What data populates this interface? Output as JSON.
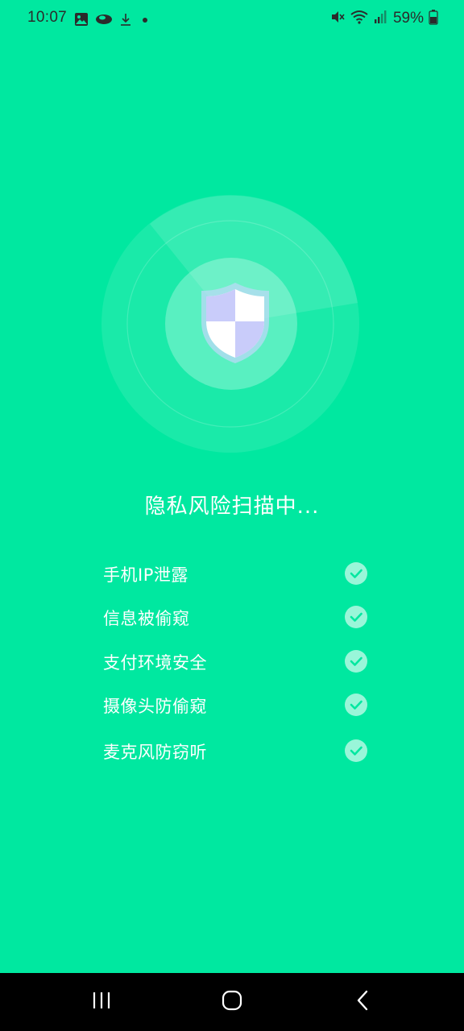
{
  "status_bar": {
    "time": "10:07",
    "battery_percent": "59%",
    "left_icons": [
      "image-icon",
      "weather-icon",
      "download-icon",
      "dot-icon"
    ],
    "right_icons": [
      "mute-icon",
      "wifi-icon",
      "signal-icon",
      "battery-icon"
    ]
  },
  "scan": {
    "title": "隐私风险扫描中...",
    "icon": "shield-icon"
  },
  "checks": [
    {
      "label": "手机IP泄露",
      "checked": true
    },
    {
      "label": "信息被偷窥",
      "checked": true
    },
    {
      "label": "支付环境安全",
      "checked": true
    },
    {
      "label": "摄像头防偷窥",
      "checked": true
    },
    {
      "label": "麦克风防窃听",
      "checked": true
    }
  ],
  "nav": {
    "buttons": [
      "recents-icon",
      "home-icon",
      "back-icon"
    ]
  },
  "colors": {
    "background": "#00E8A0",
    "status_text": "#2b2b2b",
    "shield_light": "#C9CCFA",
    "white": "#FFFFFF",
    "nav_bar": "#000000"
  }
}
